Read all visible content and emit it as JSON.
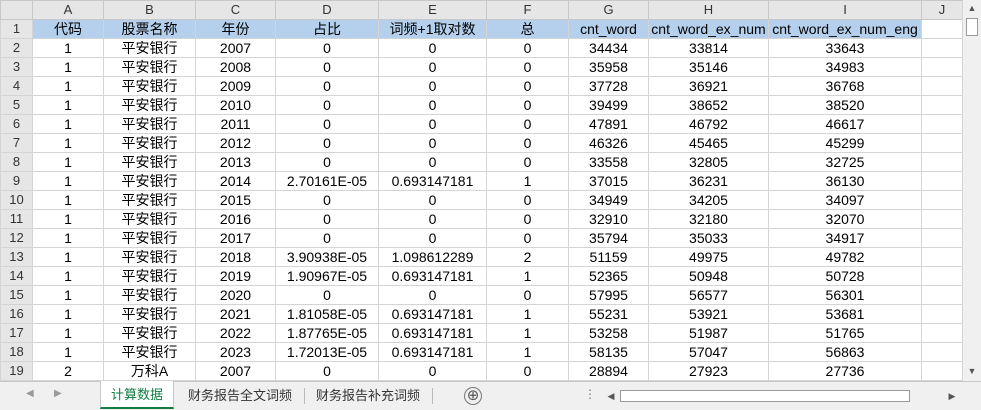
{
  "columns": [
    "A",
    "B",
    "C",
    "D",
    "E",
    "F",
    "G",
    "H",
    "I",
    "J"
  ],
  "header_row": [
    "代码",
    "股票名称",
    "年份",
    "占比",
    "词频+1取对数",
    "总",
    "cnt_word",
    "cnt_word_ex_num",
    "cnt_word_ex_num_eng",
    ""
  ],
  "rows": [
    [
      "1",
      "平安银行",
      "2007",
      "0",
      "0",
      "0",
      "34434",
      "33814",
      "33643",
      ""
    ],
    [
      "1",
      "平安银行",
      "2008",
      "0",
      "0",
      "0",
      "35958",
      "35146",
      "34983",
      ""
    ],
    [
      "1",
      "平安银行",
      "2009",
      "0",
      "0",
      "0",
      "37728",
      "36921",
      "36768",
      ""
    ],
    [
      "1",
      "平安银行",
      "2010",
      "0",
      "0",
      "0",
      "39499",
      "38652",
      "38520",
      ""
    ],
    [
      "1",
      "平安银行",
      "2011",
      "0",
      "0",
      "0",
      "47891",
      "46792",
      "46617",
      ""
    ],
    [
      "1",
      "平安银行",
      "2012",
      "0",
      "0",
      "0",
      "46326",
      "45465",
      "45299",
      ""
    ],
    [
      "1",
      "平安银行",
      "2013",
      "0",
      "0",
      "0",
      "33558",
      "32805",
      "32725",
      ""
    ],
    [
      "1",
      "平安银行",
      "2014",
      "2.70161E-05",
      "0.693147181",
      "1",
      "37015",
      "36231",
      "36130",
      ""
    ],
    [
      "1",
      "平安银行",
      "2015",
      "0",
      "0",
      "0",
      "34949",
      "34205",
      "34097",
      ""
    ],
    [
      "1",
      "平安银行",
      "2016",
      "0",
      "0",
      "0",
      "32910",
      "32180",
      "32070",
      ""
    ],
    [
      "1",
      "平安银行",
      "2017",
      "0",
      "0",
      "0",
      "35794",
      "35033",
      "34917",
      ""
    ],
    [
      "1",
      "平安银行",
      "2018",
      "3.90938E-05",
      "1.098612289",
      "2",
      "51159",
      "49975",
      "49782",
      ""
    ],
    [
      "1",
      "平安银行",
      "2019",
      "1.90967E-05",
      "0.693147181",
      "1",
      "52365",
      "50948",
      "50728",
      ""
    ],
    [
      "1",
      "平安银行",
      "2020",
      "0",
      "0",
      "0",
      "57995",
      "56577",
      "56301",
      ""
    ],
    [
      "1",
      "平安银行",
      "2021",
      "1.81058E-05",
      "0.693147181",
      "1",
      "55231",
      "53921",
      "53681",
      ""
    ],
    [
      "1",
      "平安银行",
      "2022",
      "1.87765E-05",
      "0.693147181",
      "1",
      "53258",
      "51987",
      "51765",
      ""
    ],
    [
      "1",
      "平安银行",
      "2023",
      "1.72013E-05",
      "0.693147181",
      "1",
      "58135",
      "57047",
      "56863",
      ""
    ],
    [
      "2",
      "万科A",
      "2007",
      "0",
      "0",
      "0",
      "28894",
      "27923",
      "27736",
      ""
    ]
  ],
  "tabs": [
    {
      "label": "计算数据",
      "active": true
    },
    {
      "label": "财务报告全文词频",
      "active": false
    },
    {
      "label": "财务报告补充词频",
      "active": false
    }
  ],
  "add_sheet_label": "⊕",
  "icons": {
    "nav_prev": "◀",
    "nav_next": "▶",
    "scroll_up": "▲",
    "scroll_down": "▼",
    "scroll_left": "◀",
    "scroll_right": "▶"
  },
  "colors": {
    "header_fill": "#b4d0ec",
    "active_tab": "#107c41"
  }
}
